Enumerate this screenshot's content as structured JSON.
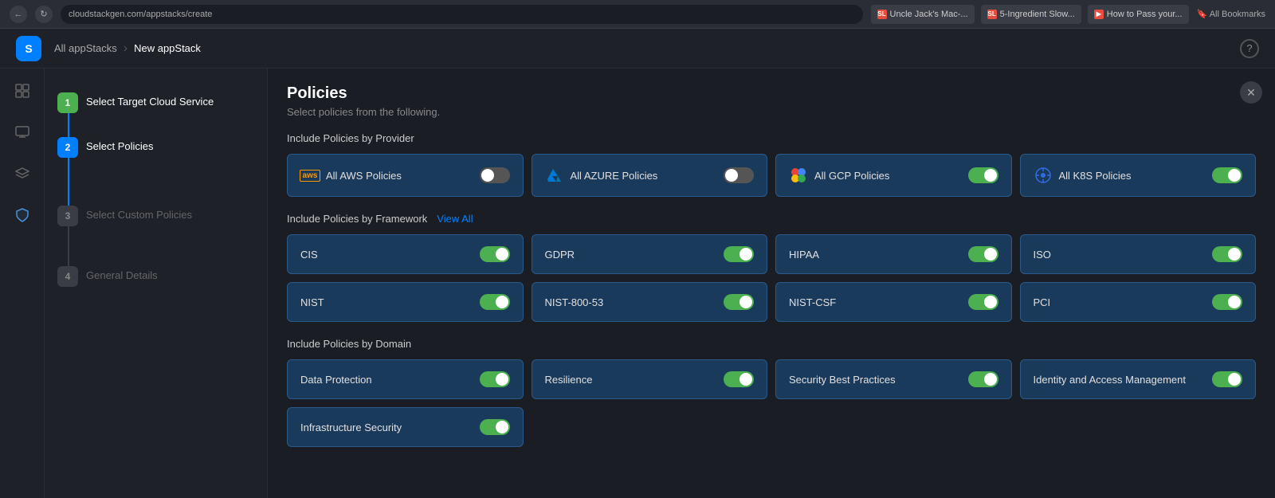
{
  "browser": {
    "url": "cloudstackgen.com/appstacks/create",
    "tabs": [
      {
        "label": "Uncle Jack's Mac-...",
        "type": "sl"
      },
      {
        "label": "5-Ingredient Slow...",
        "type": "sl"
      },
      {
        "label": "How to Pass your...",
        "type": "vid"
      }
    ],
    "bookmarks": "All Bookmarks"
  },
  "breadcrumb": {
    "parent": "All appStacks",
    "separator": ">",
    "current": "New appStack"
  },
  "steps": [
    {
      "number": "1",
      "label": "Select Target Cloud Service",
      "state": "active"
    },
    {
      "number": "2",
      "label": "Select Policies",
      "state": "current"
    },
    {
      "number": "3",
      "label": "Select Custom Policies",
      "state": "inactive"
    },
    {
      "number": "4",
      "label": "General Details",
      "state": "inactive"
    }
  ],
  "policies": {
    "title": "Policies",
    "subtitle": "Select policies from the following.",
    "provider_section": "Include Policies by Provider",
    "framework_section": "Include Policies by Framework",
    "view_all": "View All",
    "domain_section": "Include Policies by Domain",
    "providers": [
      {
        "id": "aws",
        "label": "All AWS Policies",
        "icon": "aws",
        "enabled": false
      },
      {
        "id": "azure",
        "label": "All AZURE Policies",
        "icon": "azure",
        "enabled": false
      },
      {
        "id": "gcp",
        "label": "All GCP Policies",
        "icon": "gcp",
        "enabled": true
      },
      {
        "id": "k8s",
        "label": "All K8S Policies",
        "icon": "k8s",
        "enabled": true
      }
    ],
    "frameworks": [
      {
        "id": "cis",
        "label": "CIS",
        "enabled": true
      },
      {
        "id": "gdpr",
        "label": "GDPR",
        "enabled": true
      },
      {
        "id": "hipaa",
        "label": "HIPAA",
        "enabled": true
      },
      {
        "id": "iso",
        "label": "ISO",
        "enabled": true
      },
      {
        "id": "nist",
        "label": "NIST",
        "enabled": true
      },
      {
        "id": "nist800",
        "label": "NIST-800-53",
        "enabled": true
      },
      {
        "id": "nistcsf",
        "label": "NIST-CSF",
        "enabled": true
      },
      {
        "id": "pci",
        "label": "PCI",
        "enabled": true
      }
    ],
    "domains": [
      {
        "id": "data-protection",
        "label": "Data Protection",
        "enabled": true
      },
      {
        "id": "resilience",
        "label": "Resilience",
        "enabled": true
      },
      {
        "id": "security-best-practices",
        "label": "Security Best Practices",
        "enabled": true
      },
      {
        "id": "identity-access",
        "label": "Identity and Access Management",
        "enabled": true
      },
      {
        "id": "infra-security",
        "label": "Infrastructure Security",
        "enabled": true
      }
    ]
  },
  "sidebar_icons": [
    "grid",
    "monitor",
    "layers",
    "shield",
    "help"
  ]
}
